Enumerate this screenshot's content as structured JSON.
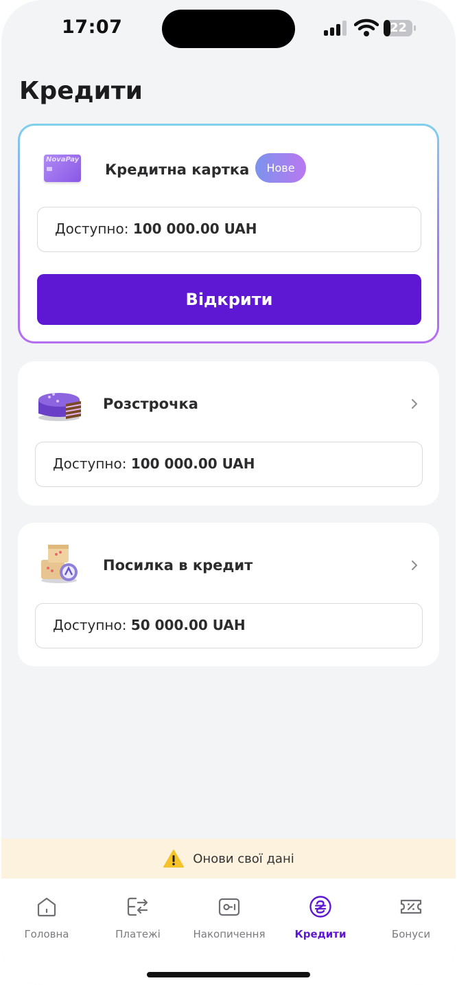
{
  "status_bar": {
    "time": "17:07",
    "battery_level": "22"
  },
  "page": {
    "title": "Кредити"
  },
  "credit_card": {
    "title": "Кредитна картка",
    "badge": "Нове",
    "card_brand": "NovaPay",
    "available_label": "Доступно:",
    "available_value": "100 000.00 UAH",
    "open_button": "Відкрити"
  },
  "installment": {
    "title": "Розстрочка",
    "available_label": "Доступно:",
    "available_value": "100 000.00 UAH"
  },
  "parcel_credit": {
    "title": "Посилка в кредит",
    "available_label": "Доступно:",
    "available_value": "50 000.00 UAH"
  },
  "warning": {
    "text": "Онови свої дані",
    "icon": "warning-icon"
  },
  "tabs": [
    {
      "label": "Головна",
      "icon": "home-icon"
    },
    {
      "label": "Платежі",
      "icon": "transfer-icon"
    },
    {
      "label": "Накопичення",
      "icon": "savings-icon"
    },
    {
      "label": "Кредити",
      "icon": "hryvnia-icon",
      "active": true
    },
    {
      "label": "Бонуси",
      "icon": "coupon-icon"
    }
  ],
  "colors": {
    "accent": "#5e17d2",
    "background": "#f3f4f6",
    "warning_bg": "#fcf2dd"
  }
}
